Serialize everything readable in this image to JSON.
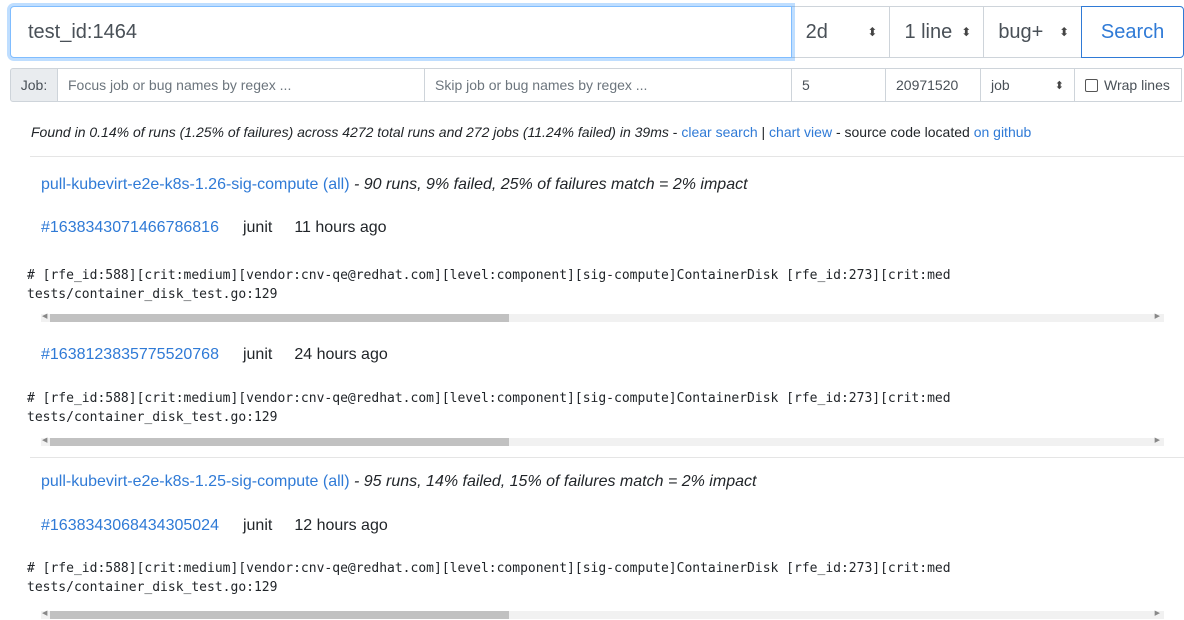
{
  "search": {
    "query": "test_id:1464",
    "max_age": "2d",
    "context": "1 line",
    "mode": "bug+",
    "button": "Search"
  },
  "filters": {
    "job_label": "Job:",
    "include_placeholder": "Focus job or bug names by regex ...",
    "exclude_placeholder": "Skip job or bug names by regex ...",
    "max_matches": "5",
    "max_bytes": "20971520",
    "group_by": "job",
    "wrap_label": "Wrap lines"
  },
  "summary": {
    "text": "Found in 0.14% of runs (1.25% of failures) across 4272 total runs and 272 jobs (11.24% failed) in 39ms",
    "sep1": " - ",
    "clear_search": "clear search",
    "sep2": " | ",
    "chart_view": "chart view",
    "source_text": " - source code located ",
    "on_github": "on github"
  },
  "results": [
    {
      "job": "pull-kubevirt-e2e-k8s-1.26-sig-compute (all)",
      "stats": " - 90 runs, 9% failed, 25% of failures match = 2% impact",
      "runs": [
        {
          "id": "#1638343071466786816",
          "type": "junit",
          "age": "11 hours ago",
          "line1": "# [rfe_id:588][crit:medium][vendor:cnv-qe@redhat.com][level:component][sig-compute]ContainerDisk [rfe_id:273][crit:med",
          "line2": "tests/container_disk_test.go:129"
        },
        {
          "id": "#1638123835775520768",
          "type": "junit",
          "age": "24 hours ago",
          "line1": "# [rfe_id:588][crit:medium][vendor:cnv-qe@redhat.com][level:component][sig-compute]ContainerDisk [rfe_id:273][crit:med",
          "line2": "tests/container_disk_test.go:129"
        }
      ]
    },
    {
      "job": "pull-kubevirt-e2e-k8s-1.25-sig-compute (all)",
      "stats": " - 95 runs, 14% failed, 15% of failures match = 2% impact",
      "runs": [
        {
          "id": "#1638343068434305024",
          "type": "junit",
          "age": "12 hours ago",
          "line1": "# [rfe_id:588][crit:medium][vendor:cnv-qe@redhat.com][level:component][sig-compute]ContainerDisk [rfe_id:273][crit:med",
          "line2": "tests/container_disk_test.go:129"
        }
      ]
    }
  ],
  "icons": {
    "select_chevron": "up-down-chevron-icon",
    "scroll_left": "scroll-left-arrow-icon",
    "scroll_right": "scroll-right-arrow-icon"
  }
}
